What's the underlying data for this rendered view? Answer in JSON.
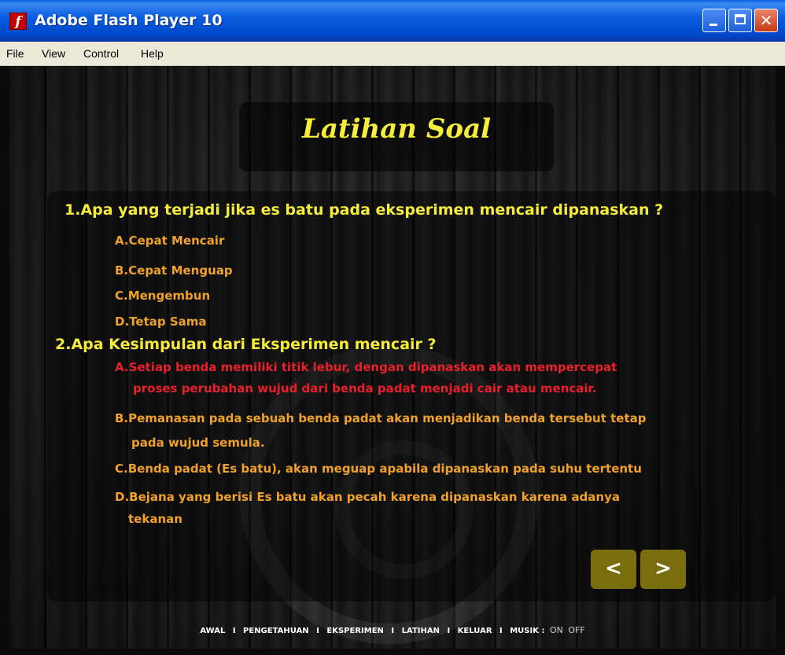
{
  "window": {
    "title": "Adobe Flash Player 10",
    "logo_glyph": "f",
    "close_glyph": "✕",
    "colors": {
      "titlebar": "#0a5ee0",
      "close_button": "#c73a16"
    }
  },
  "menu": {
    "items": [
      "File",
      "View",
      "Control",
      "Help"
    ]
  },
  "stage": {
    "title": "Latihan Soal",
    "colors": {
      "question": "#f5ec3a",
      "option": "#f0a12a",
      "selected_option": "#e8202a",
      "nav_button": "#7a6d0e"
    },
    "questions": [
      {
        "text": "1.Apa yang terjadi jika es batu pada eksperimen mencair dipanaskan ?",
        "options": [
          "A.Cepat Mencair",
          "B.Cepat Menguap",
          "C.Mengembun",
          "D.Tetap Sama"
        ]
      },
      {
        "text": "2.Apa Kesimpulan dari Eksperimen mencair ?",
        "options": [
          "A.Setiap benda memiliki titik lebur, dengan dipanaskan akan mempercepat",
          "proses perubahan wujud dari benda padat menjadi cair atau mencair.",
          "B.Pemanasan pada sebuah benda padat akan menjadikan benda tersebut tetap",
          "pada wujud semula.",
          "C.Benda padat (Es batu), akan meguap apabila dipanaskan pada suhu tertentu",
          "D.Bejana yang berisi Es batu akan pecah karena dipanaskan karena adanya",
          "tekanan"
        ]
      }
    ],
    "nav": {
      "prev": "<",
      "next": ">"
    },
    "footer": {
      "links": [
        "AWAL",
        "PENGETAHUAN",
        "EKSPERIMEN",
        "LATIHAN",
        "KELUAR",
        "MUSIK :"
      ],
      "separator": "I",
      "sound_on": "ON",
      "sound_off": "OFF"
    }
  }
}
